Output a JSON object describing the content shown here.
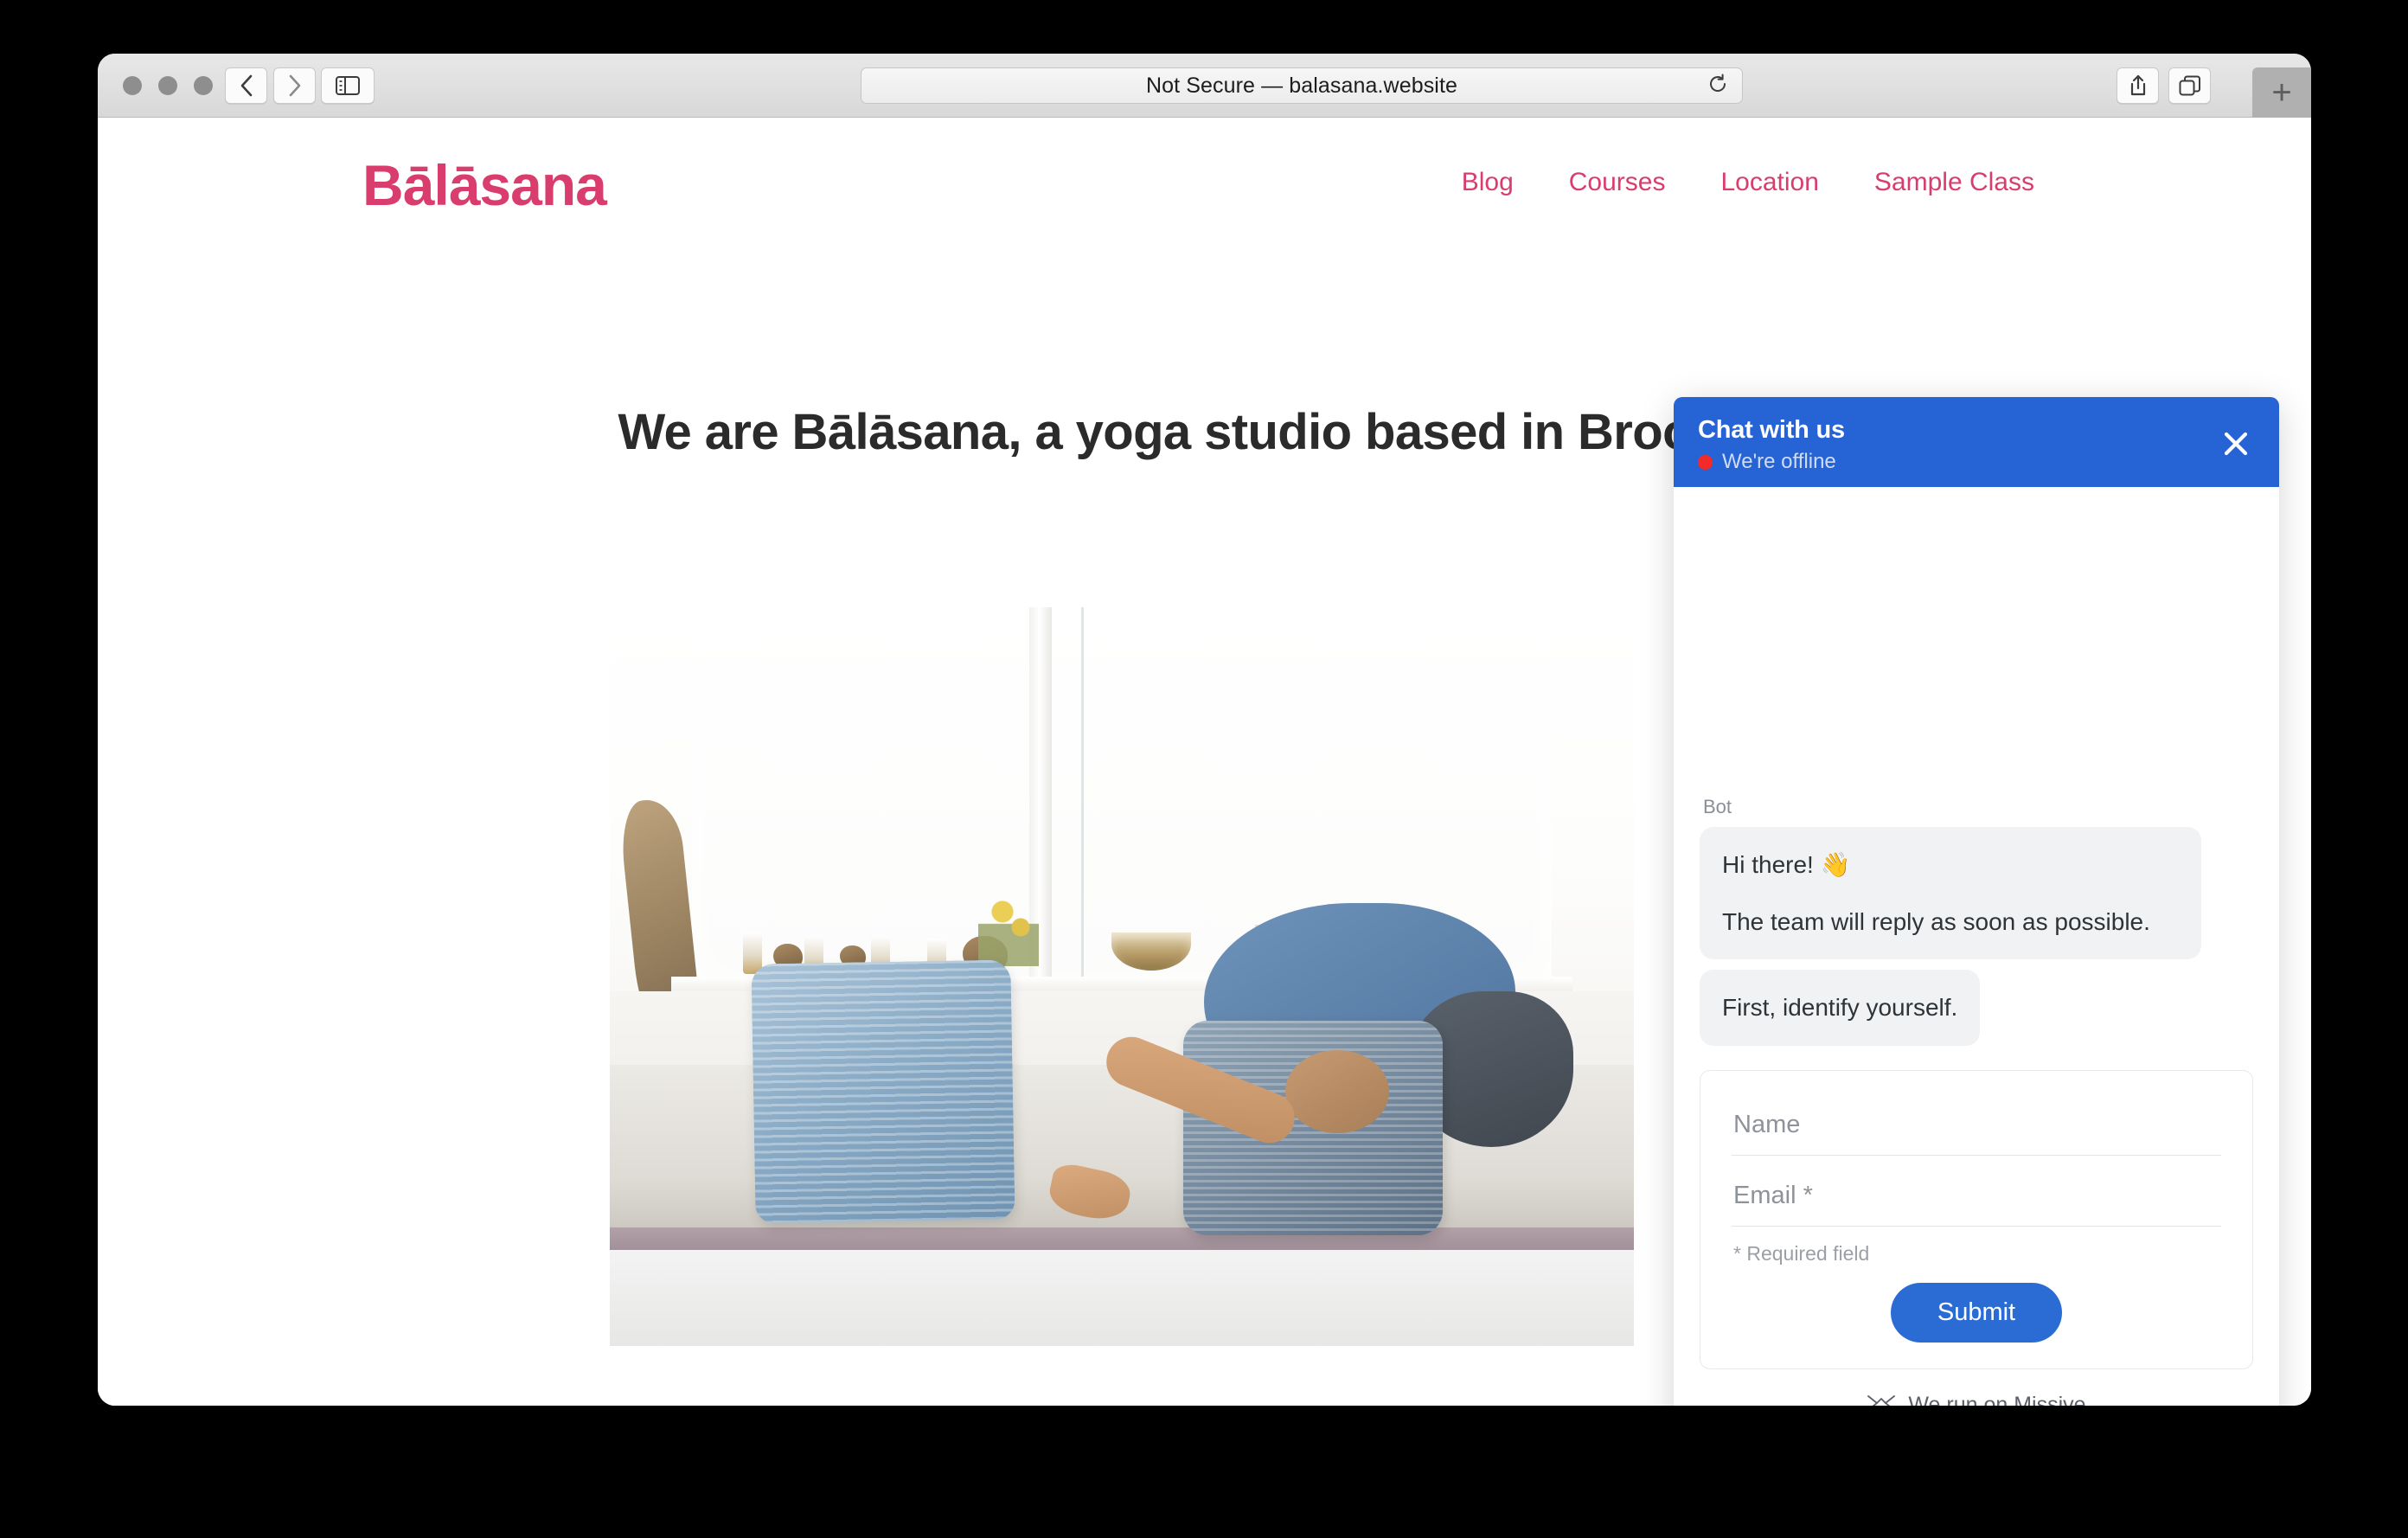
{
  "browser": {
    "address": "Not Secure — balasana.website",
    "icons": {
      "back": "chevron-left-icon",
      "forward": "chevron-right-icon",
      "sidebar": "sidebar-toggle-icon",
      "reload": "reload-icon",
      "share": "share-icon",
      "tabs": "tab-overview-icon",
      "new_tab": "+"
    }
  },
  "site": {
    "logo": "Bālāsana",
    "nav": [
      {
        "label": "Blog"
      },
      {
        "label": "Courses"
      },
      {
        "label": "Location"
      },
      {
        "label": "Sample Class"
      }
    ],
    "heading": "We are Bālāsana, a yoga studio based in Brooklyn",
    "accent_color": "#d93d6d"
  },
  "chat": {
    "title": "Chat with us",
    "status_text": "We're offline",
    "status_color": "#f22a2a",
    "header_color": "#2664d6",
    "close_icon": "close-icon",
    "sender_label": "Bot",
    "messages": [
      {
        "lines": [
          "Hi there! 👋",
          "The team will reply as soon as possible."
        ]
      },
      {
        "lines": [
          "First, identify yourself."
        ]
      }
    ],
    "form": {
      "name_placeholder": "Name",
      "name_value": "",
      "email_placeholder": "Email *",
      "email_value": "",
      "required_note": "* Required field",
      "submit_label": "Submit",
      "submit_color": "#2b6cd4"
    },
    "footer": {
      "text": "We run on Missive",
      "icon": "missive-logo-icon"
    }
  }
}
